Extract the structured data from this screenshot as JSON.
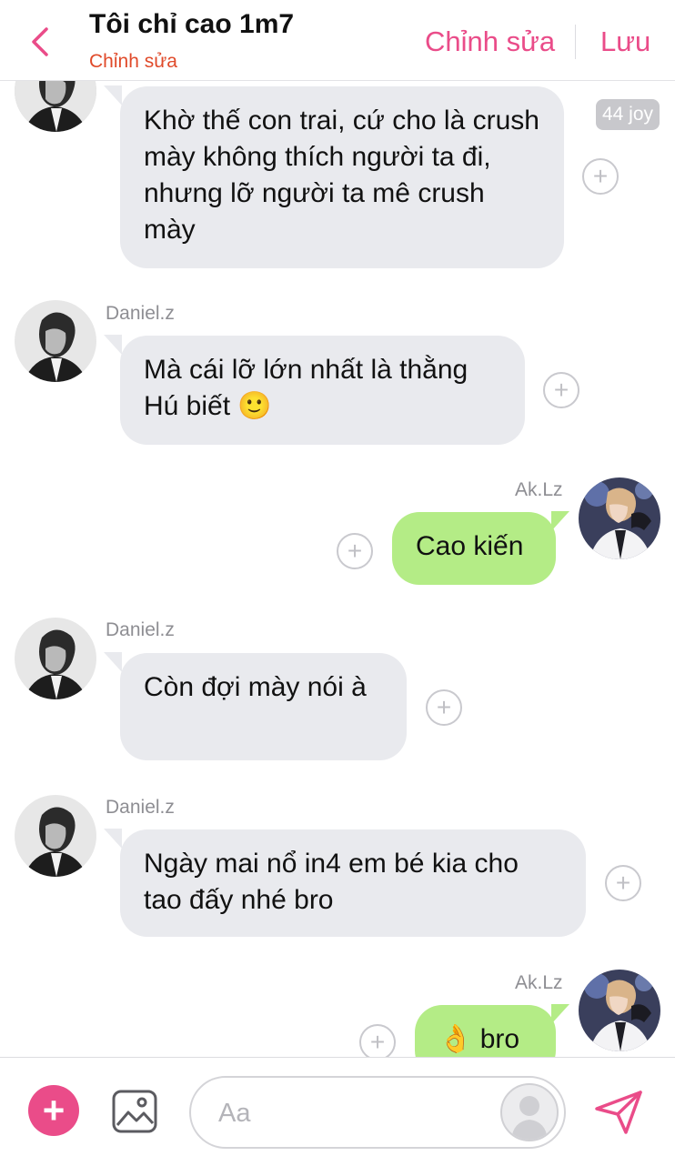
{
  "header": {
    "title": "Tôi chỉ cao 1m7",
    "subtitle": "Chỉnh sửa",
    "edit_label": "Chỉnh sửa",
    "save_label": "Lưu",
    "accent_color": "#ea4c89"
  },
  "messages": [
    {
      "direction": "incoming",
      "sender": "",
      "text": "Khờ thế con trai, cứ cho là crush mày không thích người ta đi, nhưng lỡ người ta mê crush mày",
      "reaction_badge": "44 joy"
    },
    {
      "direction": "incoming",
      "sender": "Daniel.z",
      "text": "Mà cái lỡ lớn nhất là thằng Hú biết 🙂"
    },
    {
      "direction": "outgoing",
      "sender": "Ak.Lz",
      "text": "Cao kiến"
    },
    {
      "direction": "incoming",
      "sender": "Daniel.z",
      "text": "Còn đợi mày nói à"
    },
    {
      "direction": "incoming",
      "sender": "Daniel.z",
      "text": "Ngày mai nổ in4 em bé kia cho tao đấy nhé bro"
    },
    {
      "direction": "outgoing",
      "sender": "Ak.Lz",
      "text": "👌 bro"
    }
  ],
  "composer": {
    "placeholder": "Aa"
  },
  "colors": {
    "incoming_bubble": "#e9eaee",
    "outgoing_bubble": "#b4ec86",
    "sender_name": "#8e8e93"
  }
}
